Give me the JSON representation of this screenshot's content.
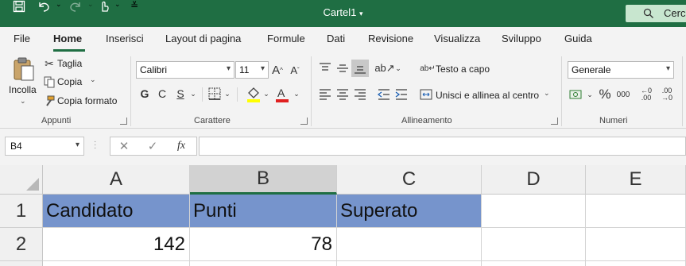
{
  "window": {
    "doc_title": "Cartel1",
    "search_placeholder": "Cerca"
  },
  "menu": {
    "tabs": [
      "File",
      "Home",
      "Inserisci",
      "Layout di pagina",
      "Formule",
      "Dati",
      "Revisione",
      "Visualizza",
      "Sviluppo",
      "Guida"
    ],
    "active": "Home"
  },
  "ribbon": {
    "clipboard": {
      "paste": "Incolla",
      "cut": "Taglia",
      "copy": "Copia",
      "format_painter": "Copia formato",
      "group": "Appunti"
    },
    "font": {
      "font_name": "Calibri",
      "font_size": "11",
      "bold": "G",
      "italic": "C",
      "underline": "S",
      "group": "Carattere"
    },
    "alignment": {
      "wrap_text": "Testo a capo",
      "merge_center": "Unisci e allinea al centro",
      "group": "Allineamento"
    },
    "number": {
      "format": "Generale",
      "group": "Numeri"
    }
  },
  "formula_bar": {
    "name_box": "B4",
    "fx": "fx",
    "formula": ""
  },
  "sheet": {
    "columns": [
      "A",
      "B",
      "C",
      "D",
      "E"
    ],
    "selected_column": "B",
    "rows": [
      {
        "num": "1",
        "cells": [
          "Candidato",
          "Punti",
          "Superato",
          "",
          ""
        ]
      },
      {
        "num": "2",
        "cells": [
          "142",
          "78",
          "",
          "",
          ""
        ]
      }
    ]
  },
  "colors": {
    "brand": "#1f6e43",
    "header_fill": "#7694cc"
  }
}
